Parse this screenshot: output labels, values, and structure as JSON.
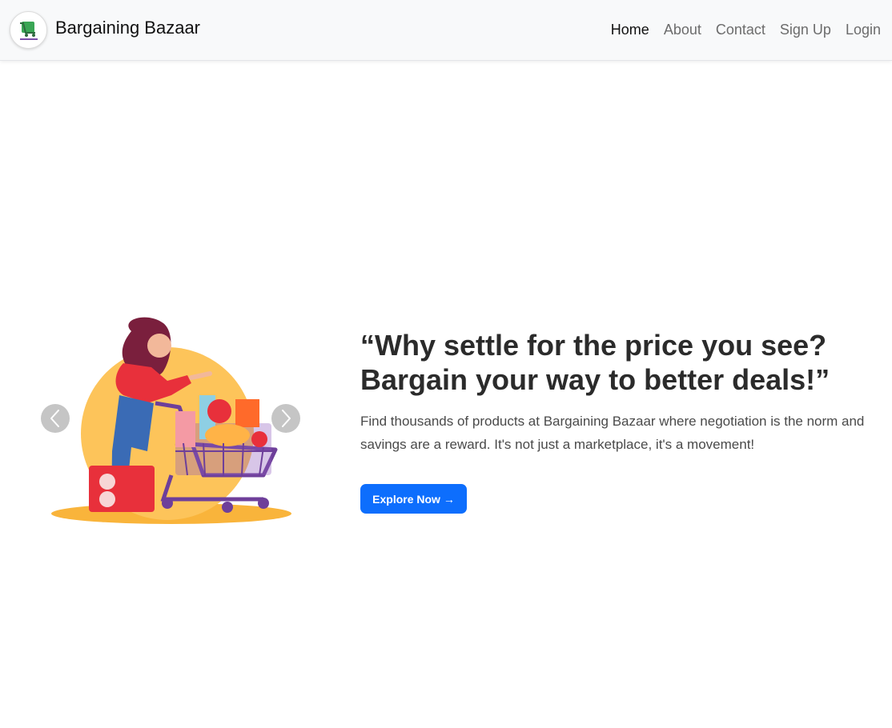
{
  "navbar": {
    "brand": "Bargaining Bazaar",
    "links": [
      {
        "label": "Home",
        "active": true
      },
      {
        "label": "About",
        "active": false
      },
      {
        "label": "Contact",
        "active": false
      },
      {
        "label": "Sign Up",
        "active": false
      },
      {
        "label": "Login",
        "active": false
      }
    ]
  },
  "carousel": {
    "prev_icon": "chevron-left-icon",
    "next_icon": "chevron-right-icon"
  },
  "hero": {
    "title": "“Why settle for the price you see? Bargain your way to better deals!”",
    "text": "Find thousands of products at Bargaining Bazaar where negotiation is the norm and savings are a reward. It's not just a marketplace, it's a movement!",
    "button_label": "Explore Now →"
  },
  "colors": {
    "primary": "#0d6efd",
    "navbar_bg": "#f8f9fa",
    "heading": "#2b2b2b"
  }
}
